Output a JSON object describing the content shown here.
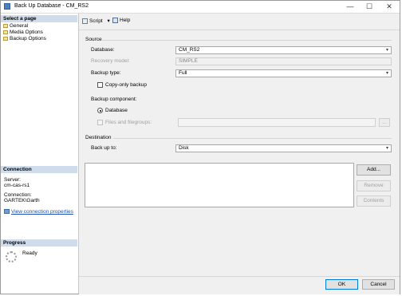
{
  "window": {
    "title": "Back Up Database - CM_RS2",
    "minimize_glyph": "—",
    "maximize_glyph": "☐",
    "close_glyph": "✕"
  },
  "left_panel": {
    "select_page_header": "Select a page",
    "pages": [
      {
        "label": "General"
      },
      {
        "label": "Media Options"
      },
      {
        "label": "Backup Options"
      }
    ],
    "connection_header": "Connection",
    "server_label": "Server:",
    "server_value": "cm-cas-rs1",
    "connection_label": "Connection:",
    "connection_value": "GARTEK\\Garth",
    "view_props_link": "View connection properties",
    "progress_header": "Progress",
    "progress_status": "Ready"
  },
  "toolbar": {
    "script_label": "Script",
    "help_label": "Help",
    "dropdown_glyph": "▾"
  },
  "source": {
    "section_label": "Source",
    "database_label": "Database:",
    "database_value": "CM_RS2",
    "recovery_label": "Recovery model:",
    "recovery_value": "SIMPLE",
    "backup_type_label": "Backup type:",
    "backup_type_value": "Full",
    "copy_only_label": "Copy-only backup",
    "copy_only_checked": false,
    "component_label": "Backup component:",
    "component_database_label": "Database",
    "component_files_label": "Files and filegroups:",
    "browse_label": "..."
  },
  "destination": {
    "section_label": "Destination",
    "backup_to_label": "Back up to:",
    "backup_to_value": "Disk",
    "list_items": [],
    "add_label": "Add...",
    "remove_label": "Remove",
    "contents_label": "Contents"
  },
  "footer": {
    "ok_label": "OK",
    "cancel_label": "Cancel"
  },
  "icons": {
    "dropdown_arrow": "chevron-down-icon"
  }
}
